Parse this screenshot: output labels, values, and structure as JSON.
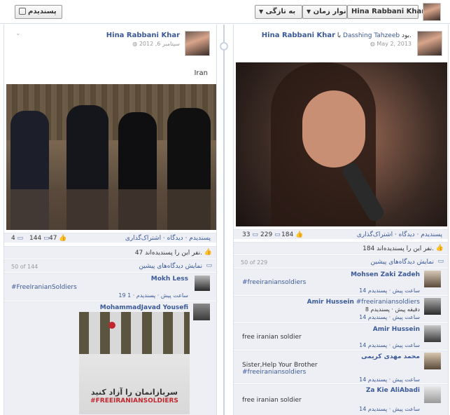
{
  "toolbar": {
    "like_label": "پسندیدم",
    "recent_label": "به تازگی",
    "timeline_label": "نوار زمان",
    "profile_name": "Hina Rabbani Khar"
  },
  "left_post": {
    "author": "Hina Rabbani Khar",
    "date": "سپتامبر 6, 2012",
    "caption": "Iran",
    "actions": "پسندیدم · دیدگاه · اشتراک‌گذاری",
    "likes_count": "47",
    "comments_count": "144",
    "shares_count": "4",
    "likes_text": "47 نفر این را پسندیده‌اند.",
    "view_comments": "نمایش دیدگاه‌های پیشین",
    "comments_range": "50 of 144",
    "comments": [
      {
        "name": "Mokh Less",
        "text": "#FreeIranianSoldiers",
        "meta": "19 ساعت پیش · پسندیدم · 1"
      },
      {
        "name": "MohammadJavad Yousefi",
        "text": "",
        "meta": ""
      }
    ],
    "poster_text_fa": "سربازانمان را آزاد کنید",
    "poster_text_en": "#FREEIRANIANSOLDIERS"
  },
  "right_post": {
    "author": "Hina Rabbani Khar",
    "with_text": "با",
    "with_name": "Dasshing Tahzeeb",
    "with_suffix": "بود.",
    "date": "May 2, 2013",
    "actions": "پسندیدم · دیدگاه · اشتراک‌گذاری",
    "likes_count": "184",
    "comments_count": "229",
    "shares_count": "33",
    "likes_text": "184 نفر این را پسندیده‌اند.",
    "view_comments": "نمایش دیدگاه‌های پیشین",
    "comments_range": "50 of 229",
    "comments": [
      {
        "name": "Mohsen Zaki Zadeh",
        "text": "#freeiraniansoldiers",
        "meta": "14 ساعت پیش · پسندیدم"
      },
      {
        "name": "Amir Hussein",
        "text": "#freeiraniansoldiers",
        "meta2": "8 دقیقه پیش · پسندیدم",
        "meta": "14 ساعت پیش · پسندیدم"
      },
      {
        "name": "Amir Hussein",
        "text": "free iranian soldier",
        "meta": "14 ساعت پیش · پسندیدم"
      },
      {
        "name": "محمد مهدی کریمی",
        "text": "Sister,Help Your Brother",
        "text2": "#freeiraniansoldiers",
        "meta": "14 ساعت پیش · پسندیدم"
      },
      {
        "name": "Za Kie AliAbadi",
        "text": "free iranian soldier",
        "meta": "14 ساعت پیش · پسندیدم"
      }
    ]
  }
}
